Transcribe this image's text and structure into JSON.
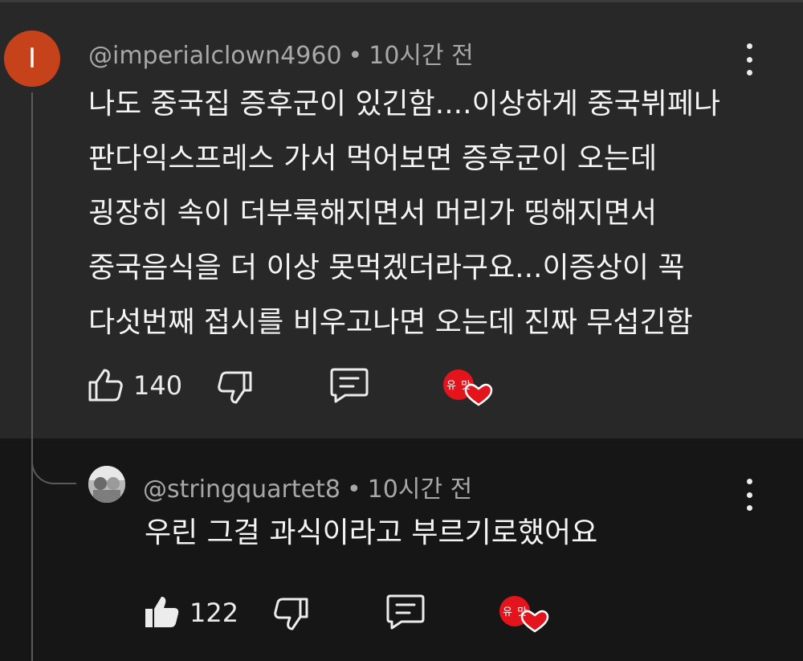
{
  "comment": {
    "avatar_initial": "I",
    "author": "@imperialclown4960",
    "separator": "•",
    "time": "10시간 전",
    "lines": [
      "나도 중국집 증후군이 있긴함....이상하게 중국뷔페나",
      "판다익스프레스 가서 먹어보면 증후군이 오는데",
      "굉장히 속이 더부룩해지면서 머리가 띵해지면서",
      "중국음식을 더 이상 못먹겠더라구요...이증상이 꼭",
      "다섯번째 접시를 비우고나면 오는데 진짜 무섭긴함"
    ],
    "likes": "140",
    "badge_text": "유 맛"
  },
  "reply": {
    "author": "@stringquartet8",
    "separator": "•",
    "time": "10시간 전",
    "text": "우린 그걸 과식이라고 부르기로했어요",
    "likes": "122",
    "badge_text": "유 맛"
  },
  "colors": {
    "comment_bg": "#282828",
    "reply_bg": "#161616",
    "avatar_bg": "#c6421b",
    "badge_red": "#e4141c"
  },
  "icons": {
    "like": "thumbs-up-icon",
    "dislike": "thumbs-down-icon",
    "reply": "reply-comment-icon",
    "menu": "more-vertical-icon",
    "creator_heart": "creator-heart-badge"
  }
}
